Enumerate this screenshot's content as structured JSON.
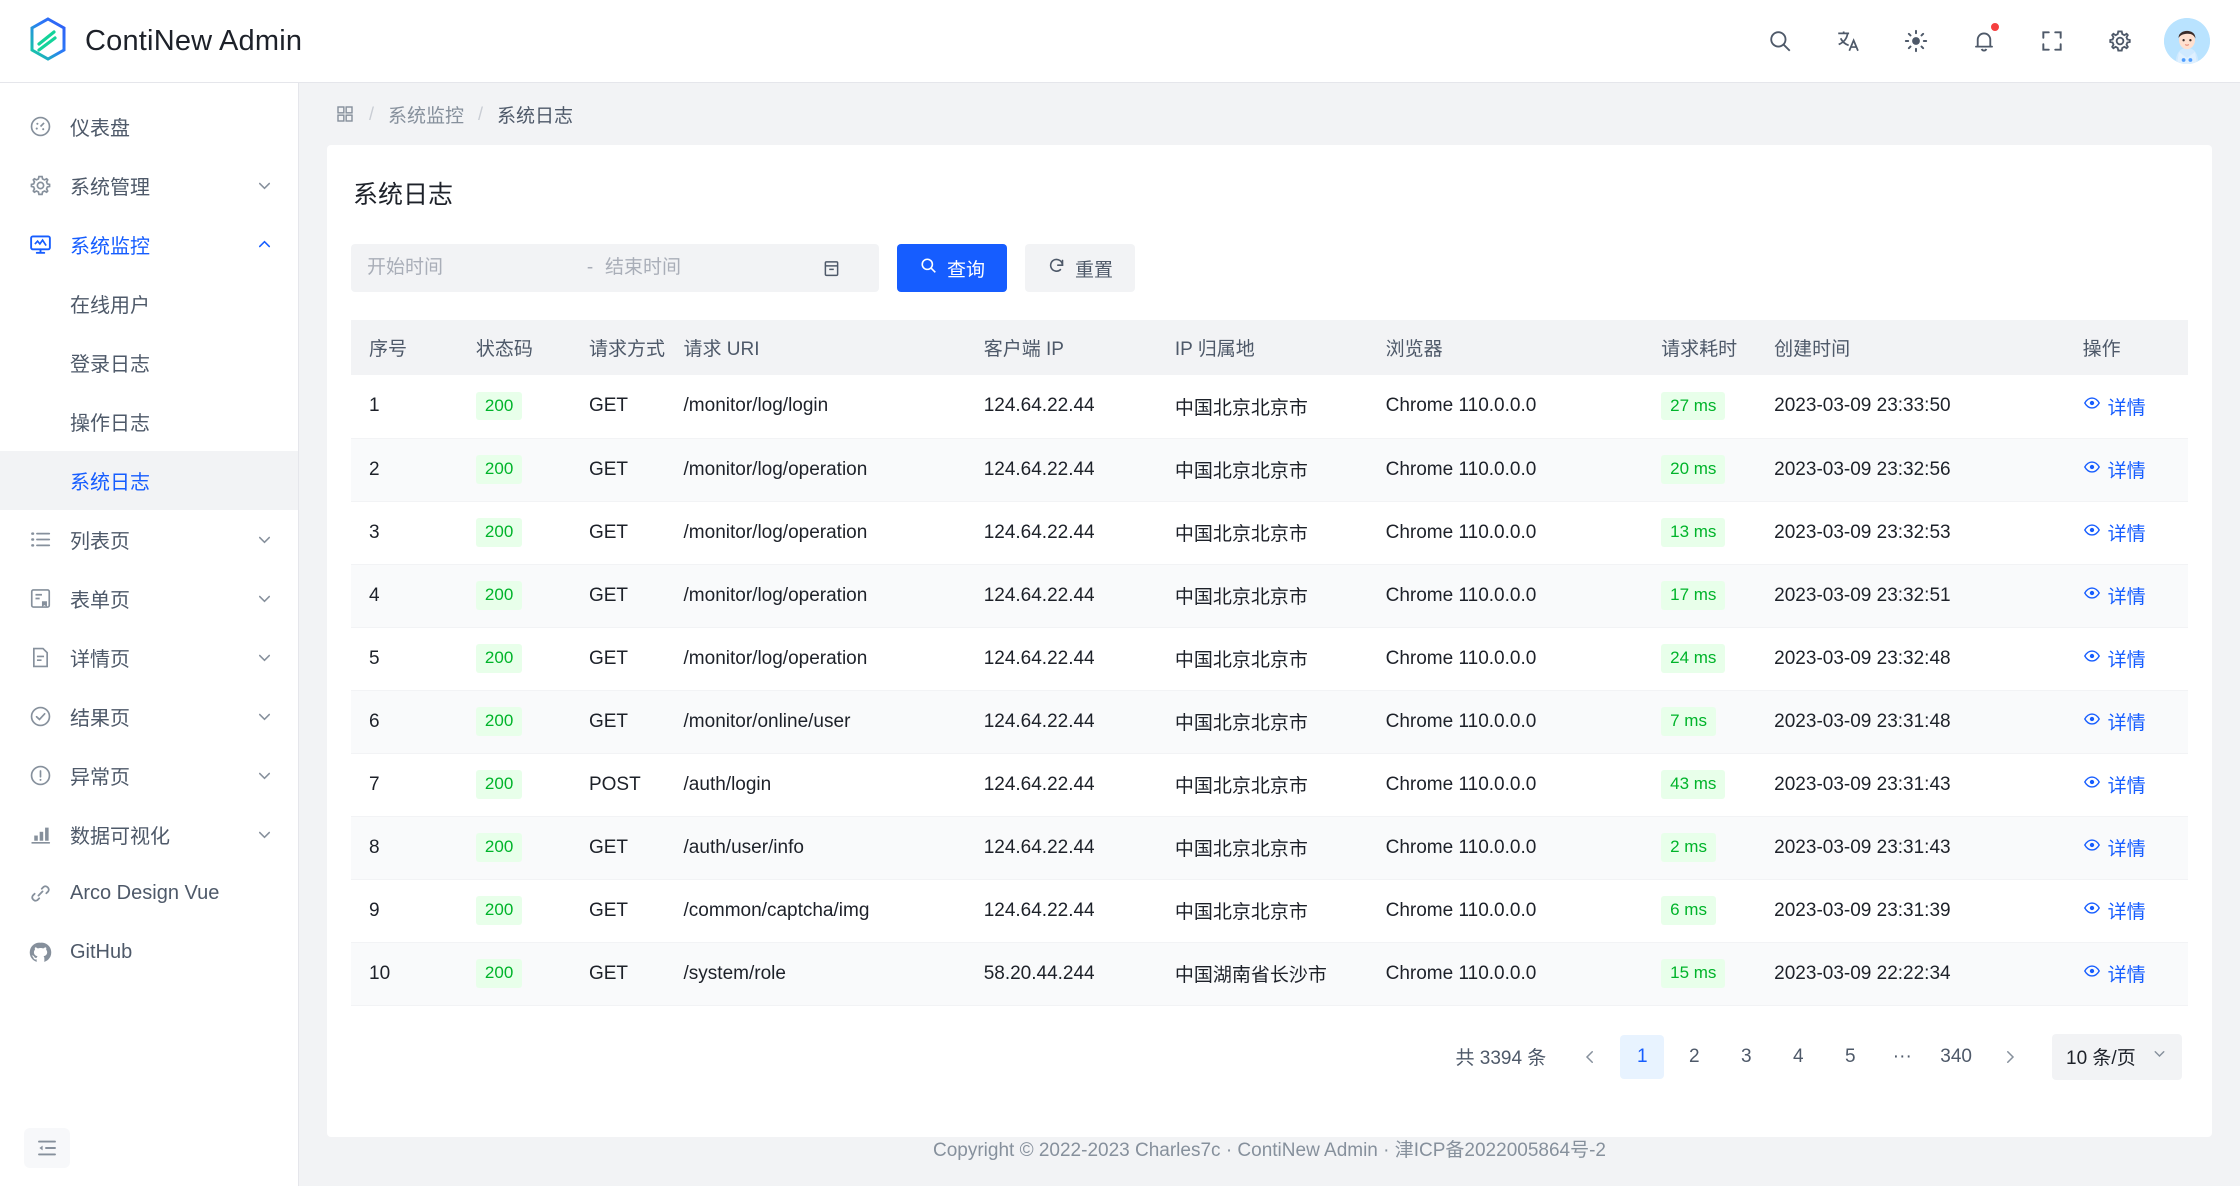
{
  "app": {
    "brand_name": "ContiNew Admin",
    "logo_icon": "hexagon-logo-icon",
    "accent_color": "#165dff",
    "success_color": "#00b42a",
    "badge_color": "#f53f3f"
  },
  "header": {
    "icons": [
      {
        "name": "search-icon",
        "label": "搜索"
      },
      {
        "name": "translate-icon",
        "label": "切换语言"
      },
      {
        "name": "brightness-icon",
        "label": "主题"
      },
      {
        "name": "bell-icon",
        "label": "消息",
        "has_badge": true
      },
      {
        "name": "fullscreen-icon",
        "label": "全屏"
      },
      {
        "name": "gear-icon",
        "label": "设置"
      },
      {
        "name": "avatar",
        "label": "用户头像"
      }
    ]
  },
  "sidebar": {
    "collapse_icon": "menu-fold-icon",
    "items": [
      {
        "label": "仪表盘",
        "icon": "dashboard-icon",
        "level": 1,
        "active": false,
        "expandable": false
      },
      {
        "label": "系统管理",
        "icon": "gear-icon",
        "level": 1,
        "active": false,
        "expandable": true,
        "expanded": false
      },
      {
        "label": "系统监控",
        "icon": "monitor-icon",
        "level": 1,
        "active": true,
        "expandable": true,
        "expanded": true
      },
      {
        "label": "在线用户",
        "level": 2,
        "active": false,
        "expandable": false
      },
      {
        "label": "登录日志",
        "level": 2,
        "active": false,
        "expandable": false
      },
      {
        "label": "操作日志",
        "level": 2,
        "active": false,
        "expandable": false
      },
      {
        "label": "系统日志",
        "level": 2,
        "active": true,
        "current": true,
        "expandable": false
      },
      {
        "label": "列表页",
        "icon": "list-icon",
        "level": 1,
        "active": false,
        "expandable": true,
        "expanded": false
      },
      {
        "label": "表单页",
        "icon": "form-icon",
        "level": 1,
        "active": false,
        "expandable": true,
        "expanded": false
      },
      {
        "label": "详情页",
        "icon": "file-icon",
        "level": 1,
        "active": false,
        "expandable": true,
        "expanded": false
      },
      {
        "label": "结果页",
        "icon": "check-circle-icon",
        "level": 1,
        "active": false,
        "expandable": true,
        "expanded": false
      },
      {
        "label": "异常页",
        "icon": "exclamation-circle-icon",
        "level": 1,
        "active": false,
        "expandable": true,
        "expanded": false
      },
      {
        "label": "数据可视化",
        "icon": "bar-chart-icon",
        "level": 1,
        "active": false,
        "expandable": true,
        "expanded": false
      },
      {
        "label": "Arco Design Vue",
        "icon": "link-icon",
        "level": 1,
        "active": false,
        "expandable": false
      },
      {
        "label": "GitHub",
        "icon": "github-icon",
        "level": 1,
        "active": false,
        "expandable": false
      }
    ]
  },
  "breadcrumb": {
    "home_icon": "apps-grid-icon",
    "items": [
      "系统监控",
      "系统日志"
    ]
  },
  "page": {
    "title": "系统日志"
  },
  "search": {
    "start_time_placeholder": "开始时间",
    "end_time_placeholder": "结束时间",
    "start_time_value": "",
    "end_time_value": "",
    "range_separator": "-",
    "calendar_icon": "calendar-icon",
    "query_label": "查询",
    "query_icon": "search-icon",
    "reset_label": "重置",
    "reset_icon": "refresh-icon"
  },
  "table": {
    "columns": [
      {
        "key": "idx",
        "label": "序号"
      },
      {
        "key": "code",
        "label": "状态码"
      },
      {
        "key": "method",
        "label": "请求方式"
      },
      {
        "key": "uri",
        "label": "请求 URI"
      },
      {
        "key": "ip",
        "label": "客户端 IP"
      },
      {
        "key": "region",
        "label": "IP 归属地"
      },
      {
        "key": "browser",
        "label": "浏览器"
      },
      {
        "key": "cost",
        "label": "请求耗时"
      },
      {
        "key": "time",
        "label": "创建时间"
      },
      {
        "key": "op",
        "label": "操作"
      }
    ],
    "detail_label": "详情",
    "detail_icon": "eye-icon",
    "rows": [
      {
        "idx": "1",
        "code": "200",
        "method": "GET",
        "uri": "/monitor/log/login",
        "ip": "124.64.22.44",
        "region": "中国北京北京市",
        "browser": "Chrome 110.0.0.0",
        "cost": "27 ms",
        "time": "2023-03-09 23:33:50"
      },
      {
        "idx": "2",
        "code": "200",
        "method": "GET",
        "uri": "/monitor/log/operation",
        "ip": "124.64.22.44",
        "region": "中国北京北京市",
        "browser": "Chrome 110.0.0.0",
        "cost": "20 ms",
        "time": "2023-03-09 23:32:56"
      },
      {
        "idx": "3",
        "code": "200",
        "method": "GET",
        "uri": "/monitor/log/operation",
        "ip": "124.64.22.44",
        "region": "中国北京北京市",
        "browser": "Chrome 110.0.0.0",
        "cost": "13 ms",
        "time": "2023-03-09 23:32:53"
      },
      {
        "idx": "4",
        "code": "200",
        "method": "GET",
        "uri": "/monitor/log/operation",
        "ip": "124.64.22.44",
        "region": "中国北京北京市",
        "browser": "Chrome 110.0.0.0",
        "cost": "17 ms",
        "time": "2023-03-09 23:32:51"
      },
      {
        "idx": "5",
        "code": "200",
        "method": "GET",
        "uri": "/monitor/log/operation",
        "ip": "124.64.22.44",
        "region": "中国北京北京市",
        "browser": "Chrome 110.0.0.0",
        "cost": "24 ms",
        "time": "2023-03-09 23:32:48"
      },
      {
        "idx": "6",
        "code": "200",
        "method": "GET",
        "uri": "/monitor/online/user",
        "ip": "124.64.22.44",
        "region": "中国北京北京市",
        "browser": "Chrome 110.0.0.0",
        "cost": "7 ms",
        "time": "2023-03-09 23:31:48"
      },
      {
        "idx": "7",
        "code": "200",
        "method": "POST",
        "uri": "/auth/login",
        "ip": "124.64.22.44",
        "region": "中国北京北京市",
        "browser": "Chrome 110.0.0.0",
        "cost": "43 ms",
        "time": "2023-03-09 23:31:43"
      },
      {
        "idx": "8",
        "code": "200",
        "method": "GET",
        "uri": "/auth/user/info",
        "ip": "124.64.22.44",
        "region": "中国北京北京市",
        "browser": "Chrome 110.0.0.0",
        "cost": "2 ms",
        "time": "2023-03-09 23:31:43"
      },
      {
        "idx": "9",
        "code": "200",
        "method": "GET",
        "uri": "/common/captcha/img",
        "ip": "124.64.22.44",
        "region": "中国北京北京市",
        "browser": "Chrome 110.0.0.0",
        "cost": "6 ms",
        "time": "2023-03-09 23:31:39"
      },
      {
        "idx": "10",
        "code": "200",
        "method": "GET",
        "uri": "/system/role",
        "ip": "58.20.44.244",
        "region": "中国湖南省长沙市",
        "browser": "Chrome 110.0.0.0",
        "cost": "15 ms",
        "time": "2023-03-09 22:22:34"
      }
    ]
  },
  "pagination": {
    "total_text": "共 3394 条",
    "prev_icon": "chevron-left-icon",
    "next_icon": "chevron-right-icon",
    "pages": [
      "1",
      "2",
      "3",
      "4",
      "5",
      "···",
      "340"
    ],
    "current_page": "1",
    "page_size_label": "10 条/页",
    "page_size_icon": "chevron-down-icon"
  },
  "footer": {
    "text": "Copyright © 2022-2023 Charles7c · ContiNew Admin · 津ICP备2022005864号-2"
  }
}
